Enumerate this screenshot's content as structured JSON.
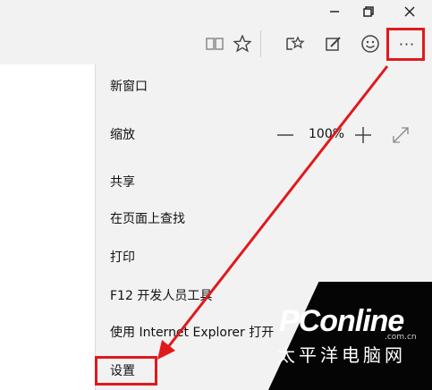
{
  "window": {
    "buttons": [
      {
        "name": "minimize",
        "icon": "minimize-icon",
        "glyph": "—"
      },
      {
        "name": "restore",
        "icon": "restore-icon",
        "glyph": "❐"
      },
      {
        "name": "close",
        "icon": "close-icon",
        "glyph": "✕"
      }
    ]
  },
  "toolbar": {
    "icons": [
      "reading-view-icon",
      "favorite-star-icon",
      "hub-icon",
      "web-note-icon",
      "feedback-smiley-icon",
      "more-actions-icon"
    ],
    "more_glyph": "···"
  },
  "menu": {
    "new_window": "新窗口",
    "zoom_label": "缩放",
    "zoom_value": "100%",
    "share": "共享",
    "find_on_page": "在页面上查找",
    "print": "打印",
    "f12_tools": "F12 开发人员工具",
    "open_with_ie": "使用 Internet Explorer 打开",
    "settings": "设置"
  },
  "highlight_color": "#e0191c",
  "watermark": {
    "logo": "PConline",
    "domain": ".com.cn",
    "chinese": "太平洋电脑网"
  }
}
